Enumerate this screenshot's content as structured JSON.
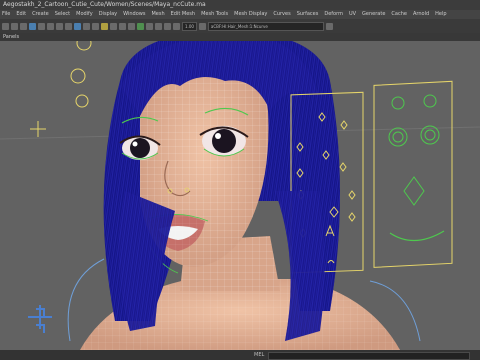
{
  "window": {
    "title": "Aegostakh_2_Cartoon_Cutie_Cute/Women/Scenes/Maya_ncCute.ma"
  },
  "menu": [
    "File",
    "Edit",
    "Create",
    "Select",
    "Modify",
    "Display",
    "Windows",
    "Mesh",
    "Edit Mesh",
    "Mesh Tools",
    "Mesh Display",
    "Curves",
    "Surfaces",
    "Deform",
    "UV",
    "Generate",
    "Cache",
    "Arnold",
    "Help"
  ],
  "toolbar": {
    "frame_value": "1.00",
    "mesh_field": "aCBF:Hl:Hair_Mesh:1:Ncurve"
  },
  "panel": {
    "menu_label": "Panels"
  },
  "status": {
    "mel_label": "MEL"
  },
  "colors": {
    "viewport_bg": "#626262",
    "hair": "#1a1890",
    "wire": "#c8c8c8",
    "skin": "#e6b79a",
    "curve_yellow": "#e6d56a",
    "curve_green": "#4ec84e"
  }
}
